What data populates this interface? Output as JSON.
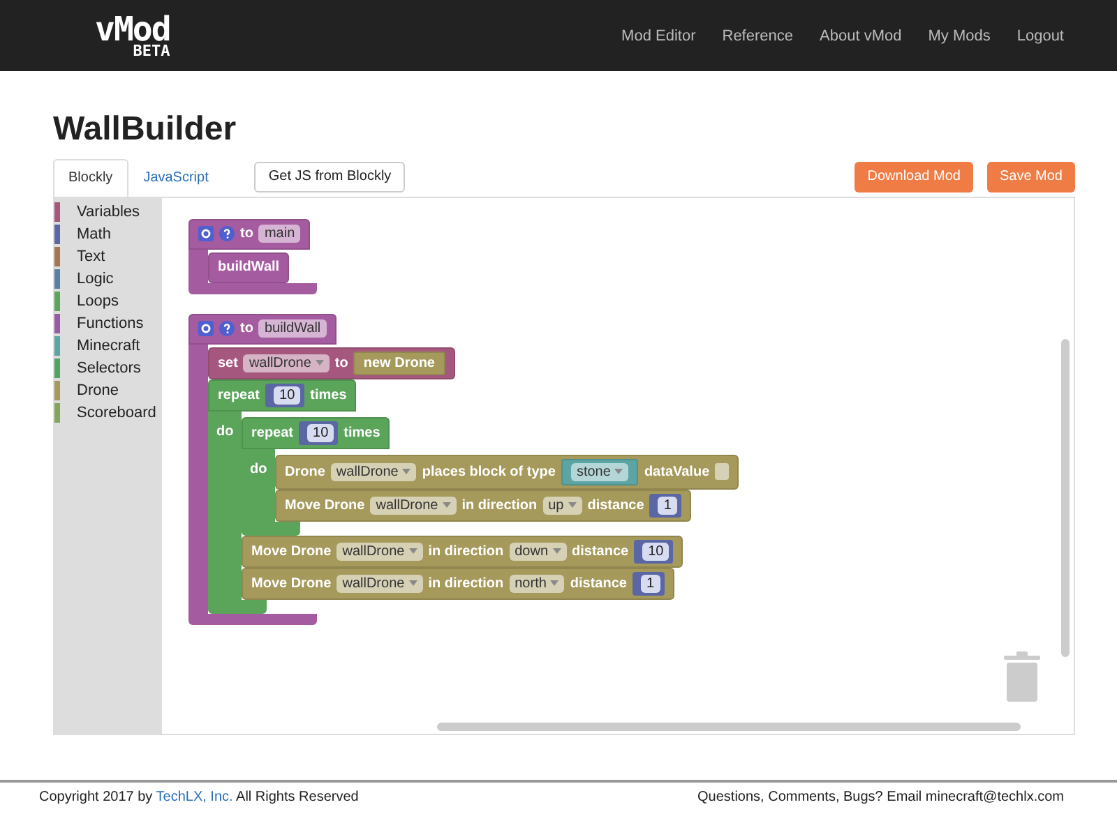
{
  "nav": {
    "logo": "vMod",
    "badge": "BETA",
    "links": [
      {
        "label": "Mod Editor"
      },
      {
        "label": "Reference"
      },
      {
        "label": "About vMod"
      },
      {
        "label": "My Mods"
      },
      {
        "label": "Logout"
      }
    ]
  },
  "title": "WallBuilder",
  "tabs": [
    {
      "label": "Blockly",
      "selected": true
    },
    {
      "label": "JavaScript",
      "selected": false
    }
  ],
  "get_js_button": "Get JS from Blockly",
  "download_button": "Download Mod",
  "save_button": "Save Mod",
  "categories": [
    {
      "label": "Variables",
      "color": "#a5577e"
    },
    {
      "label": "Math",
      "color": "#5b67a5"
    },
    {
      "label": "Text",
      "color": "#a8734f"
    },
    {
      "label": "Logic",
      "color": "#5b80a5"
    },
    {
      "label": "Loops",
      "color": "#5ba55b"
    },
    {
      "label": "Functions",
      "color": "#995ba5"
    },
    {
      "label": "Minecraft",
      "color": "#5ba5a5"
    },
    {
      "label": "Selectors",
      "color": "#4fa55f"
    },
    {
      "label": "Drone",
      "color": "#a5995b"
    },
    {
      "label": "Scoreboard",
      "color": "#84a55b"
    }
  ],
  "blocks": [
    {
      "kind": "function",
      "color": "#a55ba0",
      "parts": [
        {
          "kind": "label",
          "text": "to"
        },
        {
          "kind": "field",
          "text": "main"
        }
      ],
      "body": [
        {
          "kind": "statement",
          "color": "#a55ba0",
          "parts": [
            {
              "kind": "label",
              "text": "buildWall"
            }
          ]
        }
      ]
    },
    {
      "kind": "function",
      "color": "#a55ba0",
      "parts": [
        {
          "kind": "label",
          "text": "to"
        },
        {
          "kind": "field",
          "text": "buildWall"
        }
      ],
      "body": [
        {
          "kind": "statement",
          "color": "#a5577e",
          "parts": [
            {
              "kind": "label",
              "text": "set"
            },
            {
              "kind": "dropdown",
              "text": "wallDrone"
            },
            {
              "kind": "label",
              "text": "to"
            },
            {
              "kind": "value",
              "color": "#a5995b",
              "parts": [
                {
                  "kind": "label",
                  "text": "new Drone"
                }
              ]
            }
          ]
        },
        {
          "kind": "repeat",
          "color": "#5ba55b",
          "parts": [
            {
              "kind": "label",
              "text": "repeat"
            },
            {
              "kind": "number",
              "text": "10"
            },
            {
              "kind": "label",
              "text": "times"
            }
          ],
          "do_label": "do",
          "body": [
            {
              "kind": "repeat",
              "color": "#5ba55b",
              "parts": [
                {
                  "kind": "label",
                  "text": "repeat"
                },
                {
                  "kind": "number",
                  "text": "10"
                },
                {
                  "kind": "label",
                  "text": "times"
                }
              ],
              "do_label": "do",
              "body": [
                {
                  "kind": "statement",
                  "color": "#a5995b",
                  "parts": [
                    {
                      "kind": "label",
                      "text": "Drone"
                    },
                    {
                      "kind": "dropdown",
                      "text": "wallDrone"
                    },
                    {
                      "kind": "label",
                      "text": "places block of type"
                    },
                    {
                      "kind": "value",
                      "color": "#5ba5a5",
                      "parts": [
                        {
                          "kind": "dropdown",
                          "text": "stone"
                        }
                      ]
                    },
                    {
                      "kind": "label",
                      "text": "dataValue"
                    },
                    {
                      "kind": "socket"
                    }
                  ]
                },
                {
                  "kind": "statement",
                  "color": "#a5995b",
                  "parts": [
                    {
                      "kind": "label",
                      "text": "Move Drone"
                    },
                    {
                      "kind": "dropdown",
                      "text": "wallDrone"
                    },
                    {
                      "kind": "label",
                      "text": "in direction"
                    },
                    {
                      "kind": "dropdown",
                      "text": "up"
                    },
                    {
                      "kind": "label",
                      "text": "distance"
                    },
                    {
                      "kind": "number",
                      "text": "1"
                    }
                  ]
                }
              ]
            },
            {
              "kind": "statement",
              "color": "#a5995b",
              "parts": [
                {
                  "kind": "label",
                  "text": "Move Drone"
                },
                {
                  "kind": "dropdown",
                  "text": "wallDrone"
                },
                {
                  "kind": "label",
                  "text": "in direction"
                },
                {
                  "kind": "dropdown",
                  "text": "down"
                },
                {
                  "kind": "label",
                  "text": "distance"
                },
                {
                  "kind": "number",
                  "text": "10"
                }
              ]
            },
            {
              "kind": "statement",
              "color": "#a5995b",
              "parts": [
                {
                  "kind": "label",
                  "text": "Move Drone"
                },
                {
                  "kind": "dropdown",
                  "text": "wallDrone"
                },
                {
                  "kind": "label",
                  "text": "in direction"
                },
                {
                  "kind": "dropdown",
                  "text": "north"
                },
                {
                  "kind": "label",
                  "text": "distance"
                },
                {
                  "kind": "number",
                  "text": "1"
                }
              ]
            }
          ]
        }
      ]
    }
  ],
  "footer": {
    "copyright_before": "Copyright 2017 by ",
    "copyright_link": "TechLX, Inc.",
    "copyright_after": " All Rights Reserved",
    "contact": "Questions, Comments, Bugs? Email minecraft@techlx.com"
  }
}
